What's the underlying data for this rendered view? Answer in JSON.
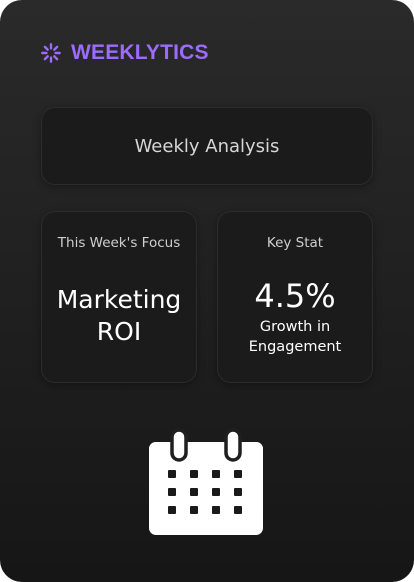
{
  "brand": {
    "name": "WEEKLYTICS",
    "icon": "loader-icon",
    "accent_color": "#9d6bff"
  },
  "banner": {
    "title": "Weekly Analysis"
  },
  "focus_card": {
    "label": "This Week's Focus",
    "value_line1": "Marketing",
    "value_line2": "ROI"
  },
  "stat_card": {
    "label": "Key Stat",
    "value": "4.5%",
    "caption_line1": "Growth in",
    "caption_line2": "Engagement"
  },
  "illustration": {
    "icon": "calendar-icon"
  }
}
